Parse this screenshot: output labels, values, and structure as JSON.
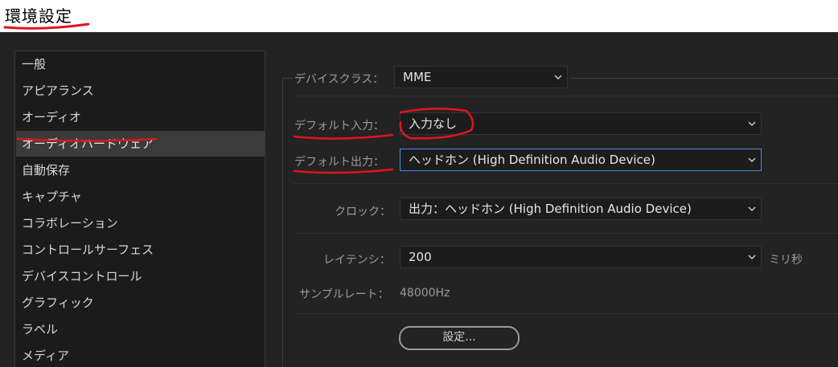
{
  "window": {
    "title": "環境設定"
  },
  "sidebar": {
    "items": [
      {
        "label": "一般"
      },
      {
        "label": "アピアランス"
      },
      {
        "label": "オーディオ"
      },
      {
        "label": "オーディオハードウェア",
        "selected": true
      },
      {
        "label": "自動保存"
      },
      {
        "label": "キャプチャ"
      },
      {
        "label": "コラボレーション"
      },
      {
        "label": "コントロールサーフェス"
      },
      {
        "label": "デバイスコントロール"
      },
      {
        "label": "グラフィック"
      },
      {
        "label": "ラベル"
      },
      {
        "label": "メディア"
      }
    ]
  },
  "device_class": {
    "label": "デバイスクラス：",
    "value": "MME"
  },
  "default_input": {
    "label": "デフォルト入力：",
    "value": "入力なし"
  },
  "default_output": {
    "label": "デフォルト出力：",
    "value": "ヘッドホン (High Definition Audio Device)"
  },
  "clock": {
    "label": "クロック：",
    "value": "出力：ヘッドホン (High Definition Audio Device)"
  },
  "latency": {
    "label": "レイテンシ：",
    "value": "200",
    "unit": "ミリ秒"
  },
  "sample_rate": {
    "label": "サンプルレート：",
    "value": "48000Hz"
  },
  "settings_button": {
    "label": "設定..."
  },
  "icons": {
    "dropdown_arrow": "chevron-down-icon"
  },
  "colors": {
    "annotation": "#e0141e",
    "focus_border": "#4b8ce0",
    "selected_item": "#3b3b3b"
  }
}
